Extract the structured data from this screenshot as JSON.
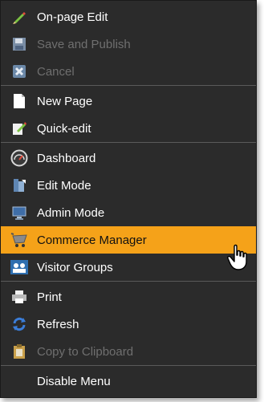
{
  "menu": {
    "items": [
      {
        "label": "On-page Edit",
        "icon": "pencil-icon",
        "enabled": true
      },
      {
        "label": "Save and Publish",
        "icon": "save-publish-icon",
        "enabled": false
      },
      {
        "label": "Cancel",
        "icon": "cancel-x-icon",
        "enabled": false
      },
      {
        "label": "New Page",
        "icon": "document-icon",
        "enabled": true
      },
      {
        "label": "Quick-edit",
        "icon": "quick-edit-icon",
        "enabled": true
      },
      {
        "label": "Dashboard",
        "icon": "gauge-icon",
        "enabled": true
      },
      {
        "label": "Edit Mode",
        "icon": "edit-mode-icon",
        "enabled": true
      },
      {
        "label": "Admin Mode",
        "icon": "monitor-icon",
        "enabled": true
      },
      {
        "label": "Commerce Manager",
        "icon": "cart-icon",
        "enabled": true,
        "highlighted": true
      },
      {
        "label": "Visitor Groups",
        "icon": "people-icon",
        "enabled": true
      },
      {
        "label": "Print",
        "icon": "printer-icon",
        "enabled": true
      },
      {
        "label": "Refresh",
        "icon": "refresh-icon",
        "enabled": true
      },
      {
        "label": "Copy to Clipboard",
        "icon": "clipboard-icon",
        "enabled": false
      },
      {
        "label": "Disable Menu",
        "icon": "",
        "enabled": true
      }
    ]
  },
  "colors": {
    "background": "#2b2b2b",
    "highlight": "#f5a219",
    "text": "#ffffff",
    "disabled_text": "#6f6f6f",
    "separator": "#5a5a5a"
  }
}
